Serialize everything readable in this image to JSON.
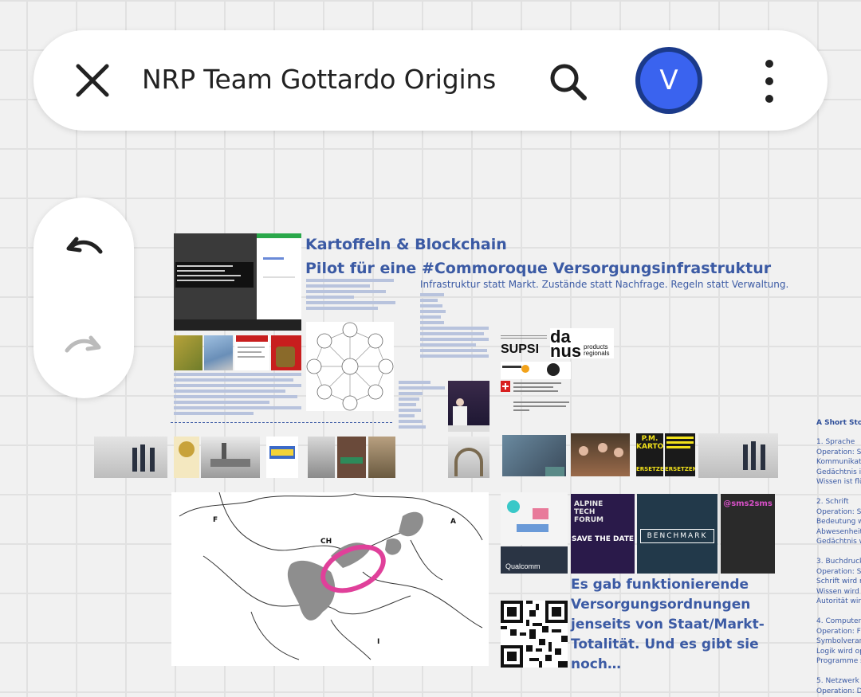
{
  "header": {
    "title": "NRP Team Gottardo Origins",
    "avatar_initial": "V",
    "icons": {
      "close": "close-icon",
      "search": "search-icon",
      "more": "more-vertical-icon"
    }
  },
  "history": {
    "icons": {
      "undo": "undo-icon",
      "redo": "redo-icon"
    }
  },
  "board": {
    "title_line1": "Kartoffeln & Blockchain",
    "title_line2": "Pilot für eine #Commoroque Versorgungsinfrastruktur",
    "subtitle": "Infrastruktur statt Markt. Zustände statt Nachfrage. Regeln statt Verwaltung.",
    "quote": "Es gab funktionierende Versorgungsordnungen jenseits von Staat/Markt-Totalität. Und es gibt sie noch…",
    "map_labels": {
      "f": "F",
      "ch": "CH",
      "a": "A",
      "i": "I"
    },
    "sponsors": {
      "supsi": "SUPSI",
      "danus_da": "da",
      "danus_nus": "nus",
      "danus_sub": "products regionals",
      "qualcomm": "Qualcomm"
    },
    "posters": {
      "kartoffeln": "P.M. KARTOFFELN",
      "save_the_date": "SAVE THE DATE",
      "alpine": "ALPINE TECH FORUM",
      "benchmark": "BENCHMARK",
      "sms2sms": "@sms2sms",
      "ersetzen1": "ERSETZEN",
      "ersetzen2": "ERSETZEN"
    },
    "side_panel": {
      "title": "A Short Story",
      "entries": [
        {
          "lines": [
            "1. Sprache",
            "Operation: Sy",
            "Kommunikati",
            "Gedächtnis is",
            "Wissen ist flü"
          ]
        },
        {
          "lines": [
            "2. Schrift",
            "Operation: Sp",
            "Bedeutung w",
            "Abwesenheit",
            "Gedächtnis w"
          ]
        },
        {
          "lines": [
            "3. Buchdruck",
            "Operation: Sk",
            "Schrift wird m",
            "Wissen wird s",
            "Autorität wird"
          ]
        },
        {
          "lines": [
            "4. Computer (",
            "Operation: Fo",
            "Symbolverarb",
            "Logik wird op",
            "Programme s"
          ]
        },
        {
          "lines": [
            "5. Netzwerk (",
            "Operation: Di"
          ]
        }
      ]
    }
  },
  "colors": {
    "accent_blue": "#3b5aa4",
    "avatar_ring": "#1b3a8a",
    "avatar_fill": "#3a63ef",
    "highlight_pink": "#e0409a"
  }
}
